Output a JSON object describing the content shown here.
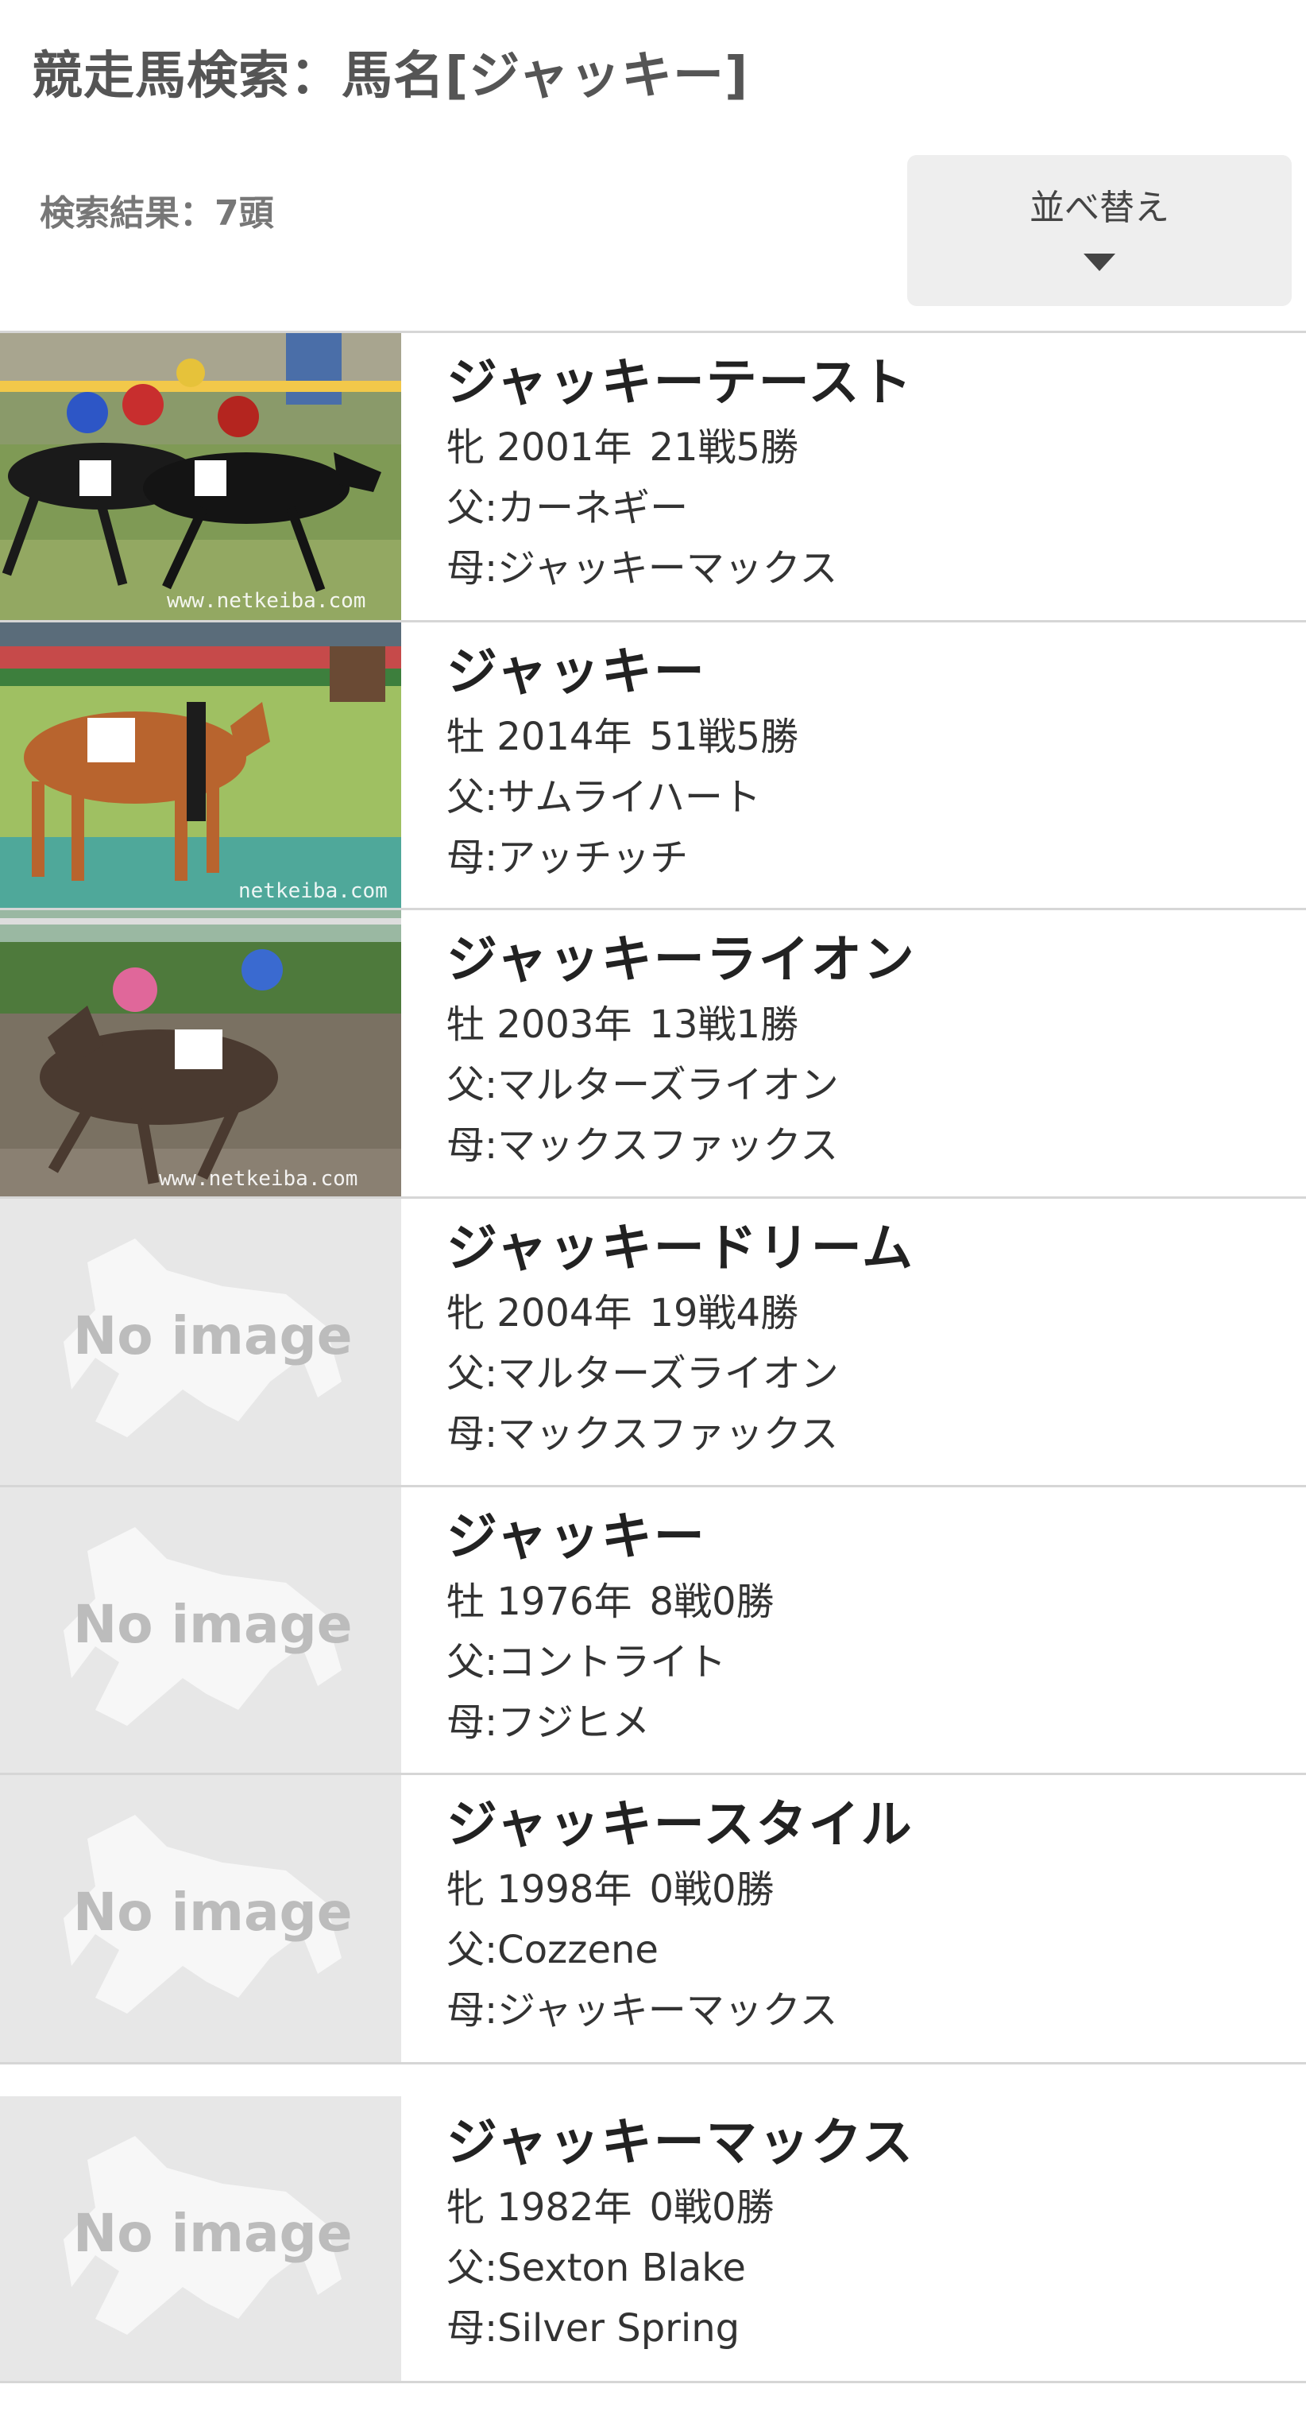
{
  "header": {
    "title": "競走馬検索：馬名[ジャッキー]",
    "result_count": "検索結果：7頭",
    "sort_label": "並べ替え",
    "sort_caret_icon": "caret-down-icon"
  },
  "horses": [
    {
      "name": "ジャッキーテースト",
      "sex": "牝",
      "year": "2001年",
      "record": "21戦5勝",
      "sire": "父:カーネギー",
      "dam": "母:ジャッキーマックス",
      "photo": "racing-photo",
      "watermark": "www.netkeiba.com"
    },
    {
      "name": "ジャッキー",
      "sex": "牡",
      "year": "2014年",
      "record": "51戦5勝",
      "sire": "父:サムライハート",
      "dam": "母:アッチッチ",
      "photo": "paddock-photo",
      "watermark": "netkeiba.com"
    },
    {
      "name": "ジャッキーライオン",
      "sex": "牡",
      "year": "2003年",
      "record": "13戦1勝",
      "sire": "父:マルターズライオン",
      "dam": "母:マックスファックス",
      "photo": "racing-photo",
      "watermark": "www.netkeiba.com"
    },
    {
      "name": "ジャッキードリーム",
      "sex": "牝",
      "year": "2004年",
      "record": "19戦4勝",
      "sire": "父:マルターズライオン",
      "dam": "母:マックスファックス",
      "photo": "no-image",
      "no_image_text": "No image"
    },
    {
      "name": "ジャッキー",
      "sex": "牡",
      "year": "1976年",
      "record": "8戦0勝",
      "sire": "父:コントライト",
      "dam": "母:フジヒメ",
      "photo": "no-image",
      "no_image_text": "No image"
    },
    {
      "name": "ジャッキースタイル",
      "sex": "牝",
      "year": "1998年",
      "record": "0戦0勝",
      "sire": "父:Cozzene",
      "dam": "母:ジャッキーマックス",
      "photo": "no-image",
      "no_image_text": "No image"
    },
    {
      "name": "ジャッキーマックス",
      "sex": "牝",
      "year": "1982年",
      "record": "0戦0勝",
      "sire": "父:Sexton Blake",
      "dam": "母:Silver Spring",
      "photo": "no-image",
      "no_image_text": "No image"
    }
  ]
}
